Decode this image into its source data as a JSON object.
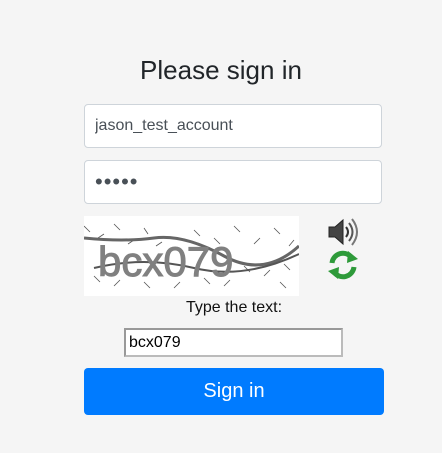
{
  "form": {
    "title": "Please sign in",
    "username_value": "jason_test_account",
    "password_value": "•••••",
    "captcha_image_text": "bcx079",
    "audio_icon": "speaker-icon",
    "refresh_icon": "refresh-icon",
    "captcha_prompt": "Type the text:",
    "captcha_value": "bcx079",
    "submit_label": "Sign in",
    "accent_color": "#007bff"
  }
}
